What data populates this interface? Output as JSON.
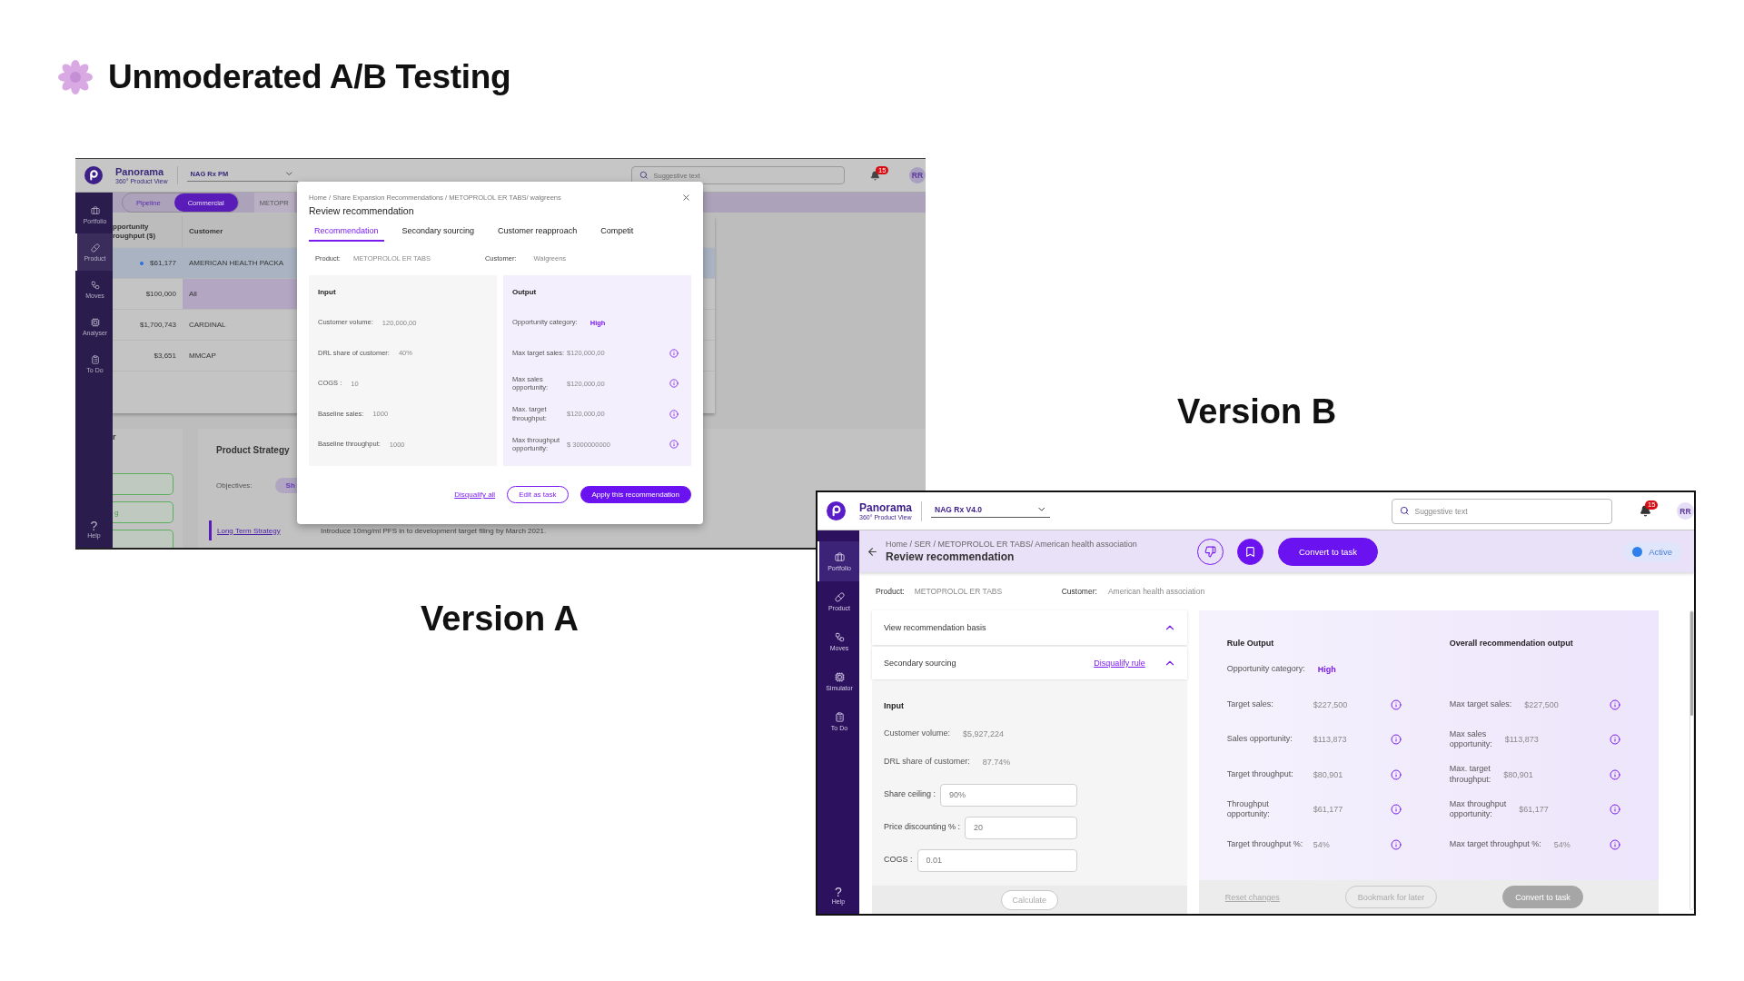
{
  "heading": {
    "title": "Unmoderated A/B Testing"
  },
  "version_a": {
    "label": "Version A",
    "screen": {
      "app": {
        "name": "Panorama",
        "subtitle": "360° Product View",
        "workspace": "NAG Rx PM",
        "search_placeholder": "Suggestive text",
        "notifications": "15",
        "avatar": "RR"
      },
      "sidebar": [
        {
          "label": "Portfolio",
          "selected": false
        },
        {
          "label": "Product",
          "selected": true
        },
        {
          "label": "Moves",
          "selected": false
        },
        {
          "label": "Analyser",
          "selected": false
        },
        {
          "label": "To Do",
          "selected": false
        }
      ],
      "help": {
        "symbol": "?",
        "label": "Help"
      },
      "toggle": [
        {
          "label": "Pipeline",
          "selected": false
        },
        {
          "label": "Commercial",
          "selected": true
        }
      ],
      "tab_cut": "METOPR",
      "table": {
        "columns": [
          "pportunity\nroughput ($)",
          "Customer"
        ],
        "rows": [
          {
            "throughput": "$61,177",
            "customer": "AMERICAN HEALTH PACKA",
            "selected": true,
            "highlighted": false
          },
          {
            "throughput": "$100,000",
            "customer": "All",
            "selected": false,
            "highlighted": true
          },
          {
            "throughput": "$1,700,743",
            "customer": "CARDINAL",
            "selected": false,
            "highlighted": false
          },
          {
            "throughput": "$3,651",
            "customer": "MMCAP",
            "selected": false,
            "highlighted": false
          }
        ]
      },
      "side_card": {
        "heading": "r",
        "pills": [
          {
            "kind": "blank"
          },
          {
            "kind": "text",
            "label": "g"
          },
          {
            "kind": "blank"
          }
        ]
      },
      "strategy": {
        "title": "Product Strategy",
        "objectives_label": "Objectives:",
        "chip": "Sh",
        "link": "Long Term Strategy",
        "description": "Introduce 10mg/ml PFS in to development target filing by March 2021."
      },
      "modal": {
        "breadcrumb": "Home / Share Expansion Recommendations / METOPROLOL ER TABS/ walgreens",
        "title": "Review recommendation",
        "tabs": [
          {
            "label": "Recommendation",
            "selected": true
          },
          {
            "label": "Secondary sourcing",
            "selected": false
          },
          {
            "label": "Customer reapproach",
            "selected": false
          },
          {
            "label": "Competit",
            "selected": false
          }
        ],
        "product_label": "Product:",
        "product": "METOPROLOL ER TABS",
        "customer_label": "Customer:",
        "customer": "Walgreens",
        "input": {
          "title": "Input",
          "rows": [
            {
              "label": "Customer volume:",
              "value": "120,000,00"
            },
            {
              "label": "DRL share of customer:",
              "value": "40%"
            },
            {
              "label": "COGS :",
              "value": "10"
            },
            {
              "label": "Baseline sales:",
              "value": "1000"
            },
            {
              "label": "Baseline throughput:",
              "value": "1000"
            }
          ]
        },
        "output": {
          "title": "Output",
          "category_label": "Opportunity category:",
          "category": "High",
          "rows": [
            {
              "label": "Max target sales:",
              "value": "$120,000,00"
            },
            {
              "label": "Max sales\nopportunity:",
              "value": "$120,000,00"
            },
            {
              "label": "Max. target\nthroughput:",
              "value": "$120,000,00"
            },
            {
              "label": "Max throughput\nopportunity:",
              "value": "$ 3000000000"
            }
          ]
        },
        "actions": {
          "disqualify": "Disqualify all",
          "edit": "Edit as task",
          "apply": "Apply this recommendation"
        }
      }
    }
  },
  "version_b": {
    "label": "Version B",
    "screen": {
      "app": {
        "name": "Panorama",
        "subtitle": "360° Product View",
        "workspace": "NAG Rx V4.0",
        "search_placeholder": "Suggestive text",
        "notifications": "15",
        "avatar": "RR"
      },
      "sidebar": [
        {
          "label": "Portfolio",
          "selected": true
        },
        {
          "label": "Product",
          "selected": false
        },
        {
          "label": "Moves",
          "selected": false
        },
        {
          "label": "Simulator",
          "selected": false
        },
        {
          "label": "To Do",
          "selected": false
        }
      ],
      "help": {
        "symbol": "?",
        "label": "Help"
      },
      "breadcrumb": "Home / SER / METOPROLOL ER TABS/ American health association",
      "title": "Review recommendation",
      "convert": "Convert to task",
      "status": "Active",
      "product_label": "Product:",
      "product": "METOPROLOL ER TABS",
      "customer_label": "Customer:",
      "customer": "American health association",
      "basis": {
        "title": "View recommendation basis",
        "expanded": true
      },
      "rule": {
        "title": "Secondary sourcing",
        "disqualify": "Disqualify rule",
        "expanded": true
      },
      "input": {
        "title": "Input",
        "rows": [
          {
            "kind": "value",
            "label": "Customer volume:",
            "value": "$5,927,224"
          },
          {
            "kind": "value",
            "label": "DRL share of customer:",
            "value": "87.74%"
          },
          {
            "kind": "field",
            "label": "Share ceiling :",
            "value": "90%"
          },
          {
            "kind": "field",
            "label": "Price discounting % :",
            "value": "20"
          },
          {
            "kind": "field",
            "label": "COGS :",
            "value": "0.01"
          }
        ]
      },
      "calculate": "Calculate",
      "rule_output": {
        "title": "Rule Output",
        "category_label": "Opportunity category:",
        "category": "High",
        "rows": [
          {
            "label": "Target sales:",
            "value": "$227,500"
          },
          {
            "label": "Sales opportunity:",
            "value": "$113,873"
          },
          {
            "label": "Target throughput:",
            "value": "$80,901"
          },
          {
            "label": "Throughput\nopportunity:",
            "value": "$61,177"
          },
          {
            "label": "Target throughput %:",
            "value": "54%"
          }
        ]
      },
      "overall_output": {
        "title": "Overall recommendation output",
        "rows": [
          {
            "label": "Max target sales:",
            "value": "$227,500"
          },
          {
            "label": "Max sales\nopportunity:",
            "value": "$113,873"
          },
          {
            "label": "Max. target\nthroughput:",
            "value": "$80,901"
          },
          {
            "label": "Max throughput\nopportunity:",
            "value": "$61,177"
          },
          {
            "label": "Max target throughput %:",
            "value": "54%"
          }
        ]
      },
      "footer": {
        "reset": "Reset changes",
        "bookmark": "Bookmark for later",
        "convert": "Convert to task"
      }
    }
  }
}
